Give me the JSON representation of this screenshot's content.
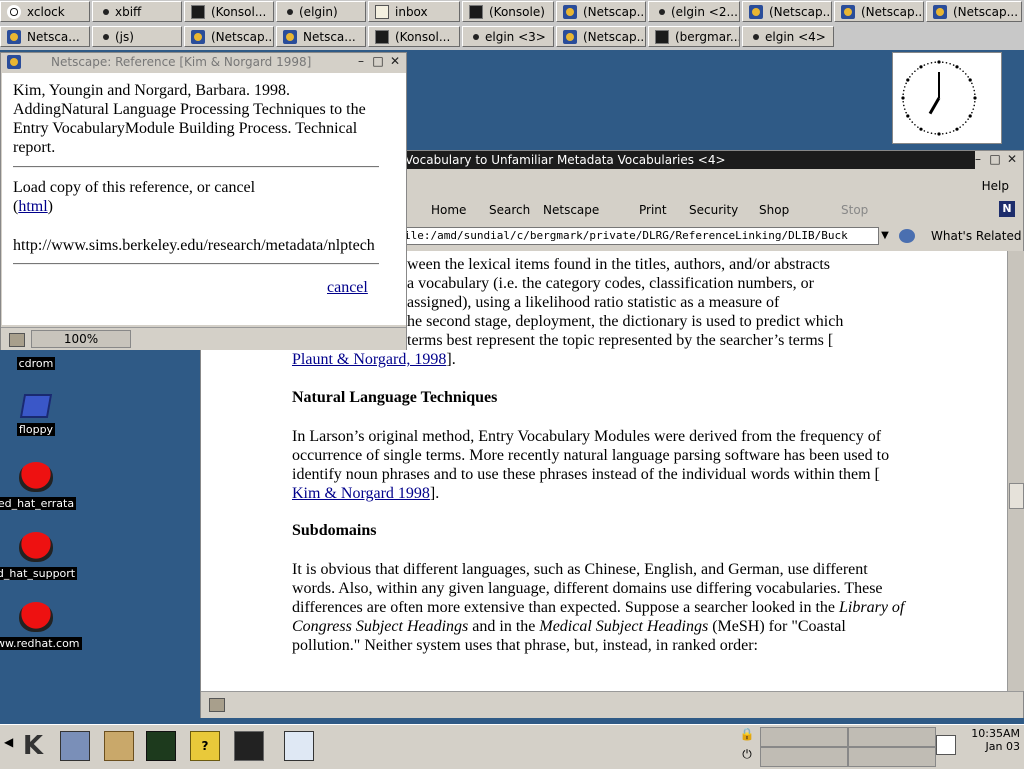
{
  "taskbar": {
    "row1": [
      {
        "label": "xclock",
        "icon": "clock-icon"
      },
      {
        "label": "xbiff",
        "icon": "dot-icon"
      },
      {
        "label": "(Konsol...",
        "icon": "terminal-icon"
      },
      {
        "label": "(elgin)",
        "icon": "dot-icon"
      },
      {
        "label": "inbox",
        "icon": "mail-icon"
      },
      {
        "label": "(Konsole)",
        "icon": "terminal-icon"
      },
      {
        "label": "(Netscap...",
        "icon": "netscape-icon"
      },
      {
        "label": "(elgin <2...",
        "icon": "dot-icon"
      },
      {
        "label": "(Netscap...",
        "icon": "netscape-icon"
      },
      {
        "label": "(Netscap...",
        "icon": "netscape-icon"
      },
      {
        "label": "(Netscap...",
        "icon": "netscape-icon"
      }
    ],
    "row2": [
      {
        "label": "Netsca...",
        "icon": "netscape-icon"
      },
      {
        "label": "(js)",
        "icon": "dot-icon"
      },
      {
        "label": "(Netscap...",
        "icon": "netscape-icon"
      },
      {
        "label": "Netsca...",
        "icon": "netscape-icon"
      },
      {
        "label": "(Konsol...",
        "icon": "terminal-icon"
      },
      {
        "label": "elgin <3>",
        "icon": "dot-icon"
      },
      {
        "label": "(Netscap...",
        "icon": "netscape-icon"
      },
      {
        "label": "(bergmar...",
        "icon": "terminal-icon"
      },
      {
        "label": "elgin <4>",
        "icon": "dot-icon"
      }
    ]
  },
  "desktop_icons": [
    {
      "label": "cdrom",
      "icon": "cdrom-icon"
    },
    {
      "label": "floppy",
      "icon": "floppy-icon"
    },
    {
      "label": "ed_hat_errata",
      "icon": "redhat-icon"
    },
    {
      "label": "d_hat_support",
      "icon": "redhat-icon"
    },
    {
      "label": "ww.redhat.com",
      "icon": "redhat-icon"
    }
  ],
  "clock": {
    "hour": 7,
    "minute": 0
  },
  "browser": {
    "title": "Vocabulary to Unfamiliar Metadata Vocabularies <4>",
    "menu_help": "Help",
    "nav": [
      "Home",
      "Search",
      "Netscape",
      "Print",
      "Security",
      "Shop",
      "Stop"
    ],
    "url": "ile:/amd/sundial/c/bergmark/private/DLRG/ReferenceLinking/DLIB/Buck",
    "whats_related": "What's Related",
    "content": {
      "intro_lines": [
        "ween the lexical items found in the titles, authors, and/or abstracts",
        "a vocabulary (i.e. the category codes, classification numbers, or",
        "assigned), using a likelihood ratio statistic as a measure of",
        "he second stage, deployment, the dictionary is used to predict which",
        "terms best represent the topic represented by the searcher’s terms ["
      ],
      "link1": "Plaunt & Norgard, 1998",
      "link1_after": "].",
      "h1": "Natural Language Techniques",
      "p1": "In Larson’s original method, Entry Vocabulary Modules were derived from the frequency of occurrence of single terms. More recently natural language parsing software has been used to identify noun phrases and to use these phrases instead of the individual words within them [",
      "link2": " Kim & Norgard 1998",
      "link2_after": "].",
      "h2": "Subdomains",
      "p2a": "It is obvious that different languages, such as Chinese, English, and German, use different words. Also, within any given language, different domains use differing vocabularies. These differences are often more extensive than expected. Suppose a searcher looked in the ",
      "p2_em1": "Library of Congress Subject Headings",
      "p2b": " and in the ",
      "p2_em2": "Medical Subject Headings",
      "p2c": " (MeSH) for \"Coastal pollution.\" Neither system uses that phrase, but, instead, in ranked order:"
    }
  },
  "popup": {
    "title": "Netscape: Reference [Kim & Norgard 1998]",
    "citation": "Kim, Youngin and Norgard, Barbara. 1998. AddingNatural Language Processing Techniques to the Entry VocabularyModule Building Process. Technical report.",
    "load_text": "Load copy of this reference, or cancel",
    "html_link": "html",
    "paren_open": "(",
    "paren_close": ")",
    "url": "http://www.sims.berkeley.edu/research/metadata/nlptech",
    "cancel": "cancel",
    "zoom": "100%"
  },
  "panel": {
    "time": "10:35AM",
    "date": "Jan 03"
  },
  "colors": {
    "desktop": "#2f5a86",
    "titlebar": "#1c1c1c",
    "link": "#00008b"
  }
}
